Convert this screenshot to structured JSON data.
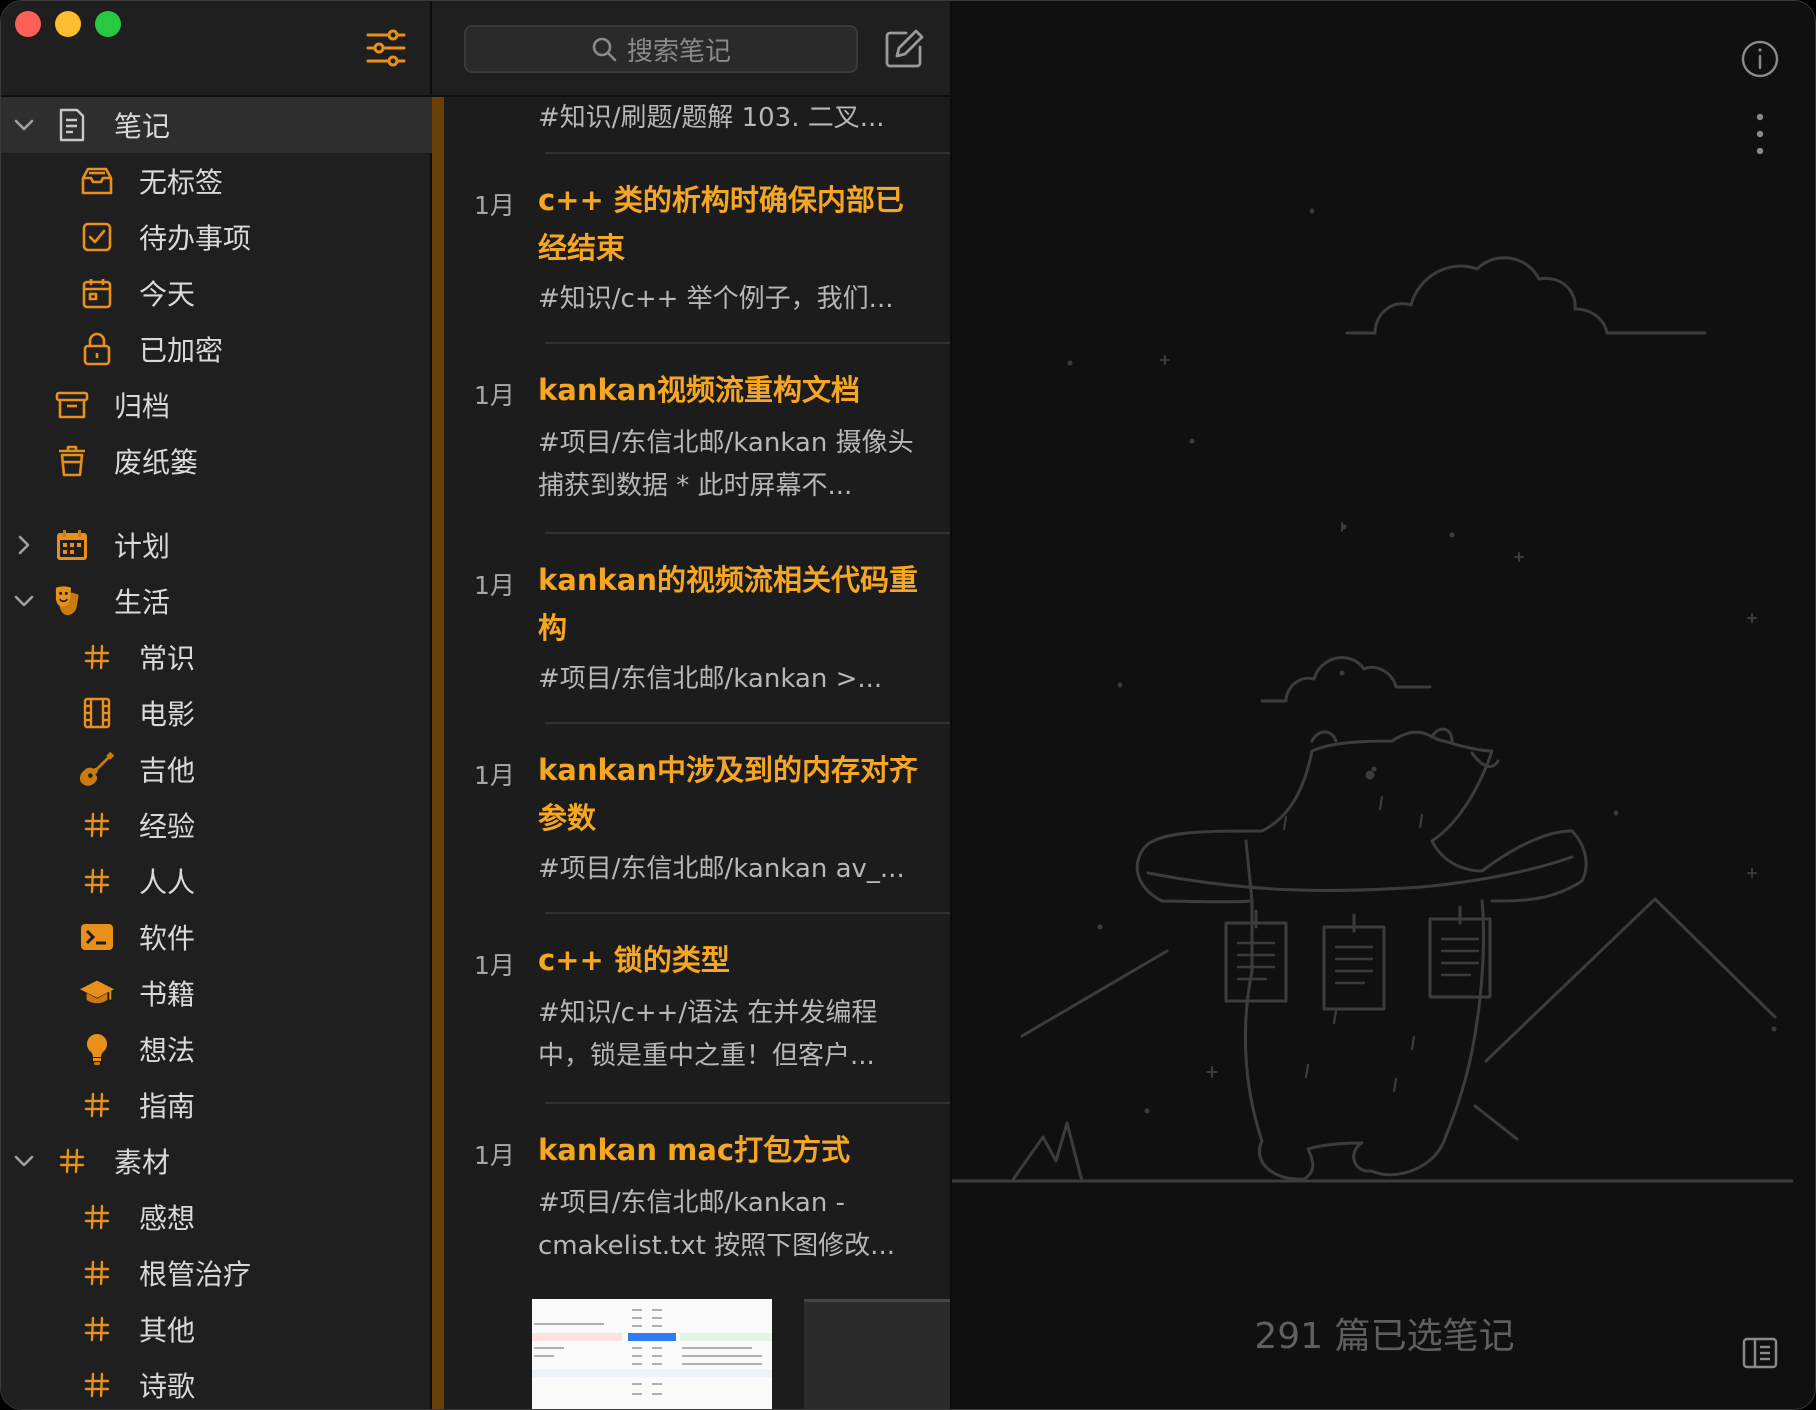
{
  "sidebar": {
    "items": [
      {
        "label": "笔记",
        "icon": "note-icon"
      },
      {
        "label": "无标签",
        "icon": "inbox-icon"
      },
      {
        "label": "待办事项",
        "icon": "checkbox-icon"
      },
      {
        "label": "今天",
        "icon": "calendar-icon"
      },
      {
        "label": "已加密",
        "icon": "lock-icon"
      },
      {
        "label": "归档",
        "icon": "archive-icon"
      },
      {
        "label": "废纸篓",
        "icon": "trash-icon"
      },
      {
        "label": "计划",
        "icon": "planner-calendar-icon"
      },
      {
        "label": "生活",
        "icon": "theater-masks-icon"
      },
      {
        "label": "常识",
        "icon": "hashtag-icon"
      },
      {
        "label": "电影",
        "icon": "film-icon"
      },
      {
        "label": "吉他",
        "icon": "guitar-icon"
      },
      {
        "label": "经验",
        "icon": "hashtag-icon"
      },
      {
        "label": "人人",
        "icon": "hashtag-icon"
      },
      {
        "label": "软件",
        "icon": "terminal-icon"
      },
      {
        "label": "书籍",
        "icon": "graduation-cap-icon"
      },
      {
        "label": "想法",
        "icon": "lightbulb-icon"
      },
      {
        "label": "指南",
        "icon": "hashtag-icon"
      },
      {
        "label": "素材",
        "icon": "hashtag-icon"
      },
      {
        "label": "感想",
        "icon": "hashtag-icon"
      },
      {
        "label": "根管治疗",
        "icon": "hashtag-icon"
      },
      {
        "label": "其他",
        "icon": "hashtag-icon"
      },
      {
        "label": "诗歌",
        "icon": "hashtag-icon"
      }
    ]
  },
  "search": {
    "placeholder": "搜索笔记"
  },
  "notes": [
    {
      "date": "",
      "title": "",
      "snippet": "#知识/刷题/题解 103. 二叉..."
    },
    {
      "date": "1月",
      "title": "c++ 类的析构时确保内部已经结束",
      "snippet": "#知识/c++ 举个例子，我们..."
    },
    {
      "date": "1月",
      "title": "kankan视频流重构文档",
      "snippet": "#项目/东信北邮/kankan 摄像头捕获到数据 * 此时屏幕不..."
    },
    {
      "date": "1月",
      "title": "kankan的视频流相关代码重构",
      "snippet": "#项目/东信北邮/kankan >..."
    },
    {
      "date": "1月",
      "title": "kankan中涉及到的内存对齐参数",
      "snippet": "#项目/东信北邮/kankan av_..."
    },
    {
      "date": "1月",
      "title": "c++ 锁的类型",
      "snippet": "#知识/c++/语法 在并发编程中，锁是重中之重！但客户..."
    },
    {
      "date": "1月",
      "title": "kankan mac打包方式",
      "snippet": "#项目/东信北邮/kankan - cmakelist.txt 按照下图修改..."
    }
  ],
  "detail": {
    "selected_count": "291 篇已选笔记"
  },
  "colors": {
    "accent": "#f5a623",
    "selected_row": "#2e2e2e",
    "list_marker": "#6b3f08"
  }
}
